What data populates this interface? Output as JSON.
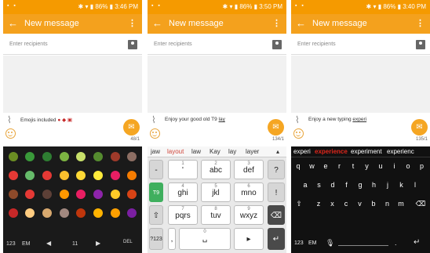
{
  "screens": [
    {
      "status_time": "3:46 PM",
      "status_battery": "86%",
      "title": "New message",
      "recipients_placeholder": "Enter recipients",
      "compose_text": "Emojis included",
      "counter": "48/1",
      "emoji_colors": [
        "#6b8e23",
        "#3a9a3a",
        "#2e7d32",
        "#7cb342",
        "#c8e06a",
        "#558b2f",
        "#9e3a2a",
        "#8d6e63",
        "#e53935",
        "#66bb6a",
        "#e53935",
        "#fbc02d",
        "#fdd835",
        "#ffeb3b",
        "#e91e63",
        "#f57c00",
        "#8d4a2a",
        "#e53935",
        "#5d4037",
        "#ff9800",
        "#e91e63",
        "#8e24aa",
        "#ffca28",
        "#d84315",
        "#c62828",
        "#ffcc80",
        "#d7a86e",
        "#a1887f",
        "#bf360c",
        "#ffb300",
        "#ffa000",
        "#7b1fa2"
      ],
      "bottom": {
        "mode": "123",
        "em": "EM",
        "page": "11",
        "del": "DEL"
      }
    },
    {
      "status_time": "3:50 PM",
      "status_battery": "86%",
      "title": "New message",
      "recipients_placeholder": "Enter recipients",
      "compose_text_a": "Enjoy your good old T9 ",
      "compose_text_b": "lay",
      "counter": "134/1",
      "suggestions": [
        "jaw",
        "layout",
        "law",
        "Kay",
        "lay",
        "layer"
      ],
      "keys": {
        "k1": "-",
        "k1d": "1",
        "k2": "abc",
        "k2d": "2",
        "k3": "def",
        "k3d": "3",
        "k4": "?",
        "k4d": "",
        "t9": "T9",
        "k5": "ghi",
        "k5d": "4",
        "k6": "jkl",
        "k6d": "5",
        "k7": "mno",
        "k7d": "6",
        "k8": "pqrs",
        "k8d": "7",
        "k9": "tuv",
        "k9d": "8",
        "k10": "wxyz",
        "k10d": "9",
        "sym": "?123",
        "space_d": "0"
      }
    },
    {
      "status_time": "3:40 PM",
      "status_battery": "86%",
      "title": "New message",
      "recipients_placeholder": "Enter recipients",
      "compose_text_a": "Enjoy a new typing ",
      "compose_text_b": "experi",
      "counter": "135/1",
      "suggestions": [
        "experi",
        "experience",
        "experiment",
        "experienc"
      ],
      "row1": [
        "q",
        "w",
        "e",
        "r",
        "t",
        "y",
        "u",
        "i",
        "o",
        "p"
      ],
      "row2": [
        "a",
        "s",
        "d",
        "f",
        "g",
        "h",
        "j",
        "k",
        "l"
      ],
      "row3": [
        "z",
        "x",
        "c",
        "v",
        "b",
        "n",
        "m"
      ],
      "bottom": {
        "mode": "123",
        "em": "EM"
      }
    }
  ]
}
